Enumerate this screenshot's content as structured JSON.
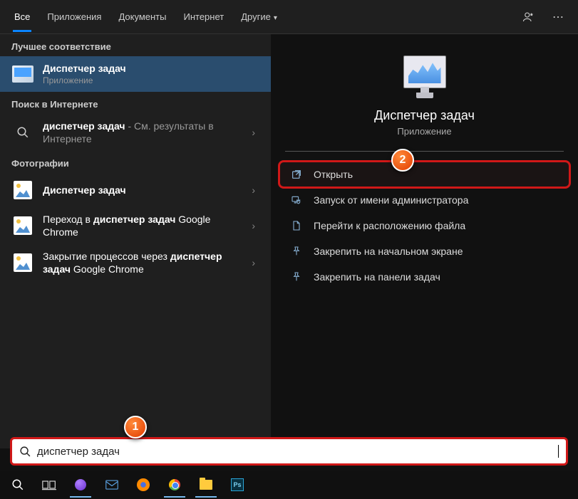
{
  "tabs": {
    "all": "Все",
    "apps": "Приложения",
    "docs": "Документы",
    "internet": "Интернет",
    "other": "Другие"
  },
  "sections": {
    "best_match": "Лучшее соответствие",
    "web_search": "Поиск в Интернете",
    "photos": "Фотографии"
  },
  "best": {
    "title": "Диспетчер задач",
    "subtitle": "Приложение"
  },
  "web": {
    "query": "диспетчер задач",
    "suffix": " - См. результаты в Интернете"
  },
  "photos_items": [
    {
      "title_html": "<b>Диспетчер задач</b>"
    },
    {
      "title_html": "Переход в <b>диспетчер задач</b> Google Chrome"
    },
    {
      "title_html": "Закрытие процессов через <b>диспетчер задач</b> Google Chrome"
    }
  ],
  "preview": {
    "title": "Диспетчер задач",
    "subtitle": "Приложение"
  },
  "actions": {
    "open": "Открыть",
    "run_admin": "Запуск от имени администратора",
    "file_location": "Перейти к расположению файла",
    "pin_start": "Закрепить на начальном экране",
    "pin_taskbar": "Закрепить на панели задач"
  },
  "search": {
    "value": "диспетчер задач"
  },
  "callouts": {
    "c1": "1",
    "c2": "2"
  }
}
